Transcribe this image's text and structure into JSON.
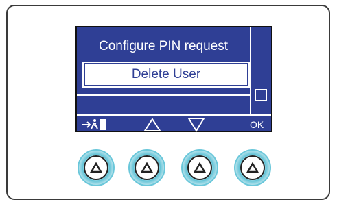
{
  "display": {
    "title": "Configure PIN request",
    "selected_item": "Delete User"
  },
  "softkeys": {
    "exit_icon": "exit-icon",
    "up_icon": "triangle-up-outline-icon",
    "down_icon": "triangle-down-outline-icon",
    "ok_label": "OK"
  },
  "buttons": [
    {
      "icon": "triangle-up-icon"
    },
    {
      "icon": "triangle-up-icon"
    },
    {
      "icon": "triangle-up-icon"
    },
    {
      "icon": "triangle-up-icon"
    }
  ],
  "colors": {
    "screen_bg": "#2f3f95",
    "button_ring": "#5fc2d6"
  }
}
